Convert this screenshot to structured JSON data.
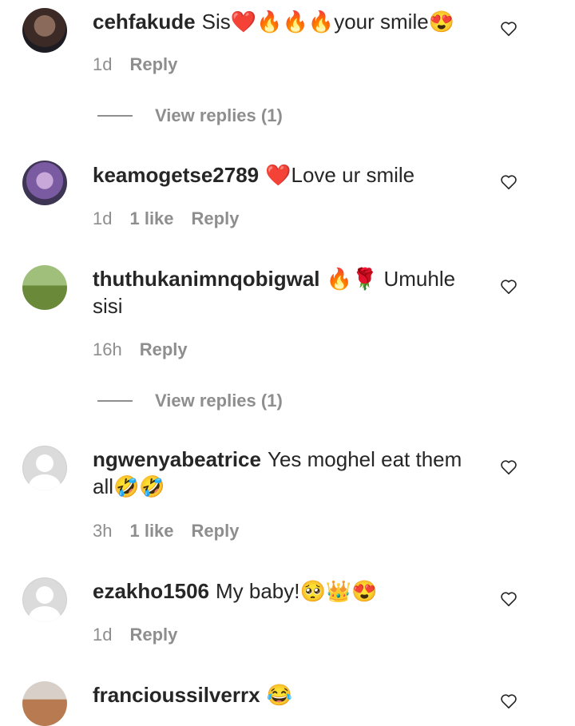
{
  "comments": [
    {
      "username": "cehfakude",
      "text": "Sis❤️🔥🔥🔥your smile😍",
      "time": "1d",
      "likes": "",
      "reply": "Reply",
      "view_replies": "View replies (1)"
    },
    {
      "username": "keamogetse2789",
      "text": "❤️Love ur smile",
      "time": "1d",
      "likes": "1 like",
      "reply": "Reply",
      "view_replies": ""
    },
    {
      "username": "thuthukanimnqobigwal",
      "text": "🔥🌹 Umuhle sisi",
      "time": "16h",
      "likes": "",
      "reply": "Reply",
      "view_replies": "View replies (1)"
    },
    {
      "username": "ngwenyabeatrice",
      "text": "Yes moghel eat them all🤣🤣",
      "time": "3h",
      "likes": "1 like",
      "reply": "Reply",
      "view_replies": ""
    },
    {
      "username": "ezakho1506",
      "text": "My baby!🥺👑😍",
      "time": "1d",
      "likes": "",
      "reply": "Reply",
      "view_replies": ""
    },
    {
      "username": "francioussilverrx",
      "text": "😂",
      "time": "",
      "likes": "",
      "reply": "",
      "view_replies": ""
    }
  ],
  "icons": {
    "like": "heart-outline-icon",
    "avatar_default": "default-avatar-icon"
  },
  "colors": {
    "text": "#262626",
    "secondary": "#8e8e8e",
    "background": "#ffffff"
  }
}
